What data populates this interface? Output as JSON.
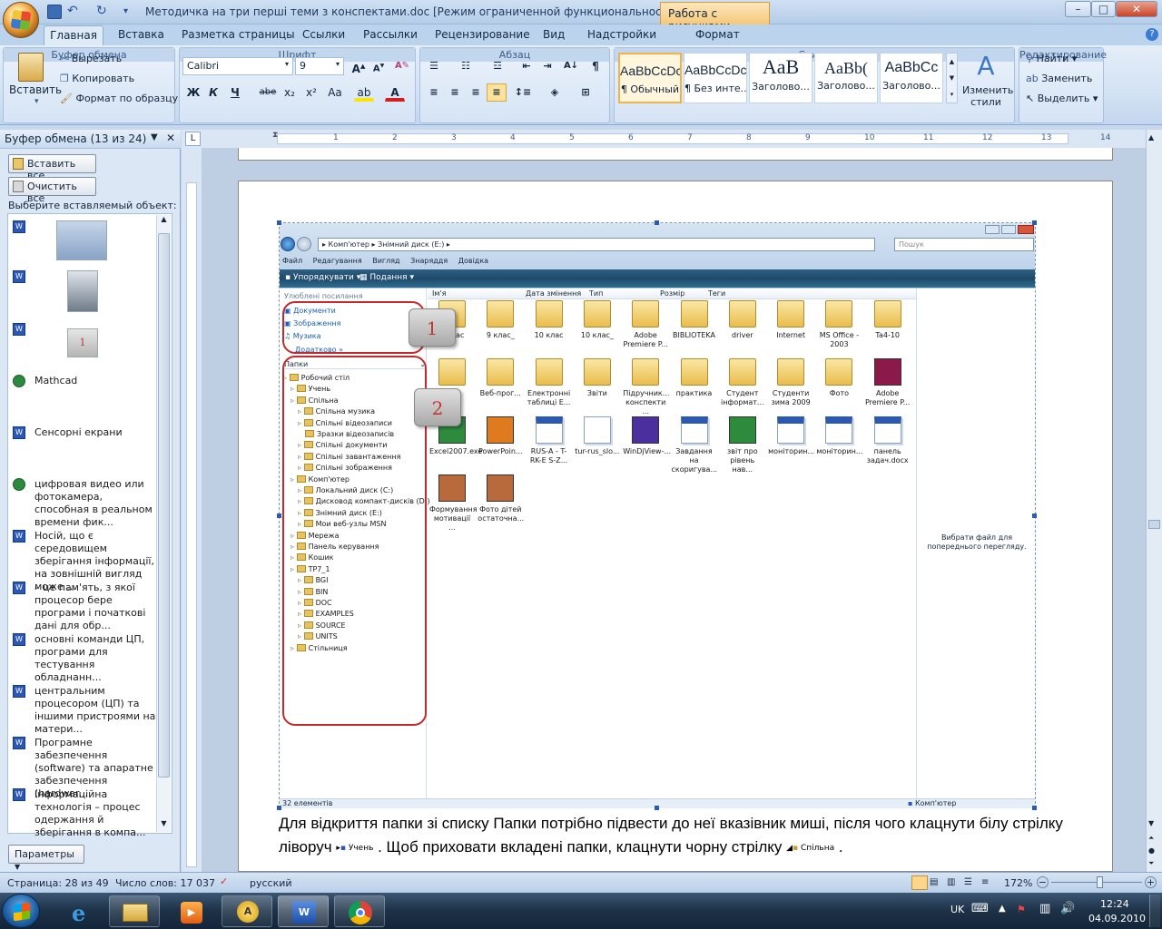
{
  "window": {
    "title": "Методичка на три перші теми з конспектами.doc [Режим ограниченной функциональности] - Mi...",
    "context_tab": "Работа с рисунками",
    "context_subtab": "Формат",
    "controls": {
      "minimize": "–",
      "maximize": "□",
      "close": "✕"
    }
  },
  "tabs": [
    "Главная",
    "Вставка",
    "Разметка страницы",
    "Ссылки",
    "Рассылки",
    "Рецензирование",
    "Вид",
    "Надстройки"
  ],
  "ribbon": {
    "clipboard": {
      "paste": "Вставить",
      "cut": "Вырезать",
      "copy": "Копировать",
      "format_painter": "Формат по образцу",
      "label": "Буфер обмена"
    },
    "font": {
      "name": "Calibri",
      "size": "9",
      "bold": "Ж",
      "italic": "К",
      "underline": "Ч",
      "strike": "abe",
      "sub": "x₂",
      "sup": "x²",
      "case": "Aa",
      "label": "Шрифт"
    },
    "paragraph": {
      "label": "Абзац"
    },
    "styles": {
      "items": [
        {
          "sample": "AaBbCcDc",
          "name": "¶ Обычный"
        },
        {
          "sample": "AaBbCcDc",
          "name": "¶ Без инте..."
        },
        {
          "sample": "AaB",
          "name": "Заголово..."
        },
        {
          "sample": "AaBb(",
          "name": "Заголово..."
        },
        {
          "sample": "AaBbCc",
          "name": "Заголово..."
        }
      ],
      "change": "Изменить стили",
      "label": "Стили"
    },
    "editing": {
      "find": "Найти",
      "replace": "Заменить",
      "select": "Выделить",
      "label": "Редактирование"
    }
  },
  "clipboard_pane": {
    "title": "Буфер обмена (13 из 24)",
    "paste_all": "Вставить все",
    "clear_all": "Очистить все",
    "prompt": "Выберите вставляемый объект:",
    "items": [
      {
        "type": "image",
        "text": ""
      },
      {
        "type": "image",
        "text": ""
      },
      {
        "type": "image",
        "text": "1"
      },
      {
        "type": "text",
        "text": "Mathcad"
      },
      {
        "type": "text",
        "text": "Сенсорні екрани"
      },
      {
        "type": "text",
        "text": "цифровая видео или фотокамера, способная в реальном времени фик..."
      },
      {
        "type": "text",
        "text": "Носій, що є середовищем зберігання інформації, на зовнішній вигляд може ..."
      },
      {
        "type": "text",
        "text": "– це пам'ять, з якої процесор бере програми і початкові дані для обр..."
      },
      {
        "type": "text",
        "text": "основні команди ЦП, програми для тестування обладнанн..."
      },
      {
        "type": "text",
        "text": "центральним процесором (ЦП) та іншими пристроями на матери..."
      },
      {
        "type": "text",
        "text": "Програмне забезпечення (software) та апаратне забезпечення (hardwar..."
      },
      {
        "type": "text",
        "text": "Інформаційна технологія – процес одержання й зберігання в компа..."
      }
    ],
    "options": "Параметры"
  },
  "ruler_numbers": [
    "1",
    "2",
    "3",
    "4",
    "5",
    "6",
    "7",
    "8",
    "9",
    "10",
    "11",
    "12",
    "13",
    "14"
  ],
  "explorer": {
    "address": "▸ Комп'ютер ▸ Знімний диск (E:) ▸",
    "search_placeholder": "Пошук",
    "menu": [
      "Файл",
      "Редагування",
      "Вигляд",
      "Знаряддя",
      "Довідка"
    ],
    "commands": [
      "Упорядкувати",
      "Подання"
    ],
    "favorites_title": "Улюблені посилання",
    "favorites": [
      "Документи",
      "Зображення",
      "Музика",
      "Додатково"
    ],
    "folders_label": "Папки",
    "tree": [
      {
        "label": "Робочий стіл",
        "level": 0
      },
      {
        "label": "Учень",
        "level": 1
      },
      {
        "label": "Спільна",
        "level": 1
      },
      {
        "label": "Спільна музика",
        "level": 2
      },
      {
        "label": "Спільні відеозаписи",
        "level": 2
      },
      {
        "label": "Зразки відеозаписів",
        "level": 3
      },
      {
        "label": "Спільні документи",
        "level": 2
      },
      {
        "label": "Спільні завантаження",
        "level": 2
      },
      {
        "label": "Спільні зображення",
        "level": 2
      },
      {
        "label": "Комп'ютер",
        "level": 1
      },
      {
        "label": "Локальний диск (C:)",
        "level": 2
      },
      {
        "label": "Дисковод компакт-дисків (D:)",
        "level": 2
      },
      {
        "label": "Знімний диск (E:)",
        "level": 2
      },
      {
        "label": "Мои веб-узлы MSN",
        "level": 2
      },
      {
        "label": "Мережа",
        "level": 1
      },
      {
        "label": "Панель керування",
        "level": 1
      },
      {
        "label": "Кошик",
        "level": 1
      },
      {
        "label": "TP7_1",
        "level": 1
      },
      {
        "label": "BGI",
        "level": 2
      },
      {
        "label": "BIN",
        "level": 2
      },
      {
        "label": "DOC",
        "level": 2
      },
      {
        "label": "EXAMPLES",
        "level": 2
      },
      {
        "label": "SOURCE",
        "level": 2
      },
      {
        "label": "UNITS",
        "level": 2
      },
      {
        "label": "Стільниця",
        "level": 1
      }
    ],
    "columns": [
      "Ім'я",
      "Дата змінення",
      "Тип",
      "Розмір",
      "Теги"
    ],
    "files": [
      {
        "name": "8 клас",
        "kind": "folder"
      },
      {
        "name": "9 клас_",
        "kind": "folder"
      },
      {
        "name": "10 клас",
        "kind": "folder"
      },
      {
        "name": "10 клас_",
        "kind": "folder"
      },
      {
        "name": "Adobe Premiere P...",
        "kind": "folder"
      },
      {
        "name": "BIBLIOTEKA",
        "kind": "folder"
      },
      {
        "name": "driver",
        "kind": "folder"
      },
      {
        "name": "Internet",
        "kind": "folder"
      },
      {
        "name": "MS Office - 2003",
        "kind": "folder"
      },
      {
        "name": "Ta4-10",
        "kind": "folder"
      },
      {
        "name": "",
        "kind": "folder"
      },
      {
        "name": "Веб-прог...",
        "kind": "folder"
      },
      {
        "name": "Електронні таблиці Е...",
        "kind": "folder"
      },
      {
        "name": "Звіти",
        "kind": "folder"
      },
      {
        "name": "Підручник... конспекти ...",
        "kind": "folder"
      },
      {
        "name": "практика",
        "kind": "folder"
      },
      {
        "name": "Студент інформат...",
        "kind": "folder"
      },
      {
        "name": "Студенти зима 2009",
        "kind": "folder"
      },
      {
        "name": "Фото",
        "kind": "folder"
      },
      {
        "name": "Adobe Premiere P...",
        "kind": "archive"
      },
      {
        "name": "Excel2007.exe",
        "kind": "excel"
      },
      {
        "name": "PowerPoin...",
        "kind": "ppt"
      },
      {
        "name": "RUS-A - T-RK-E S-Z...",
        "kind": "word"
      },
      {
        "name": "tur-rus_slo...",
        "kind": "blank"
      },
      {
        "name": "WinDjView-...",
        "kind": "djvu"
      },
      {
        "name": "Завдання на скоригува...",
        "kind": "word"
      },
      {
        "name": "звіт про рівень нав...",
        "kind": "excel"
      },
      {
        "name": "моніторин...",
        "kind": "word"
      },
      {
        "name": "моніторин...",
        "kind": "word"
      },
      {
        "name": "панель задач.docx",
        "kind": "word"
      },
      {
        "name": "Формування мотивації ...",
        "kind": "img"
      },
      {
        "name": "Фото дітей остаточна...",
        "kind": "img"
      }
    ],
    "preview_text": "Вибрати файл для попереднього перегляду.",
    "status_left": "32 елементів",
    "status_right": "Комп'ютер"
  },
  "callouts": [
    "1",
    "2"
  ],
  "paragraph": {
    "part1": "Для відкриття папки зі списку Папки потрібно підвести до неї вказівник  миші, після чого клацнути білу стрілку ліворуч ",
    "inline1": "Учень",
    "part2": " . Щоб приховати вкладені папки, клацнути чорну стрілку ",
    "inline2": "Спільна",
    "part3": " ."
  },
  "statusbar": {
    "page": "Страница: 28 из 49",
    "words": "Число слов: 17 037",
    "language": "русский",
    "zoom": "172%"
  },
  "taskbar": {
    "lang": "UK",
    "time": "12:24",
    "date": "04.09.2010"
  }
}
